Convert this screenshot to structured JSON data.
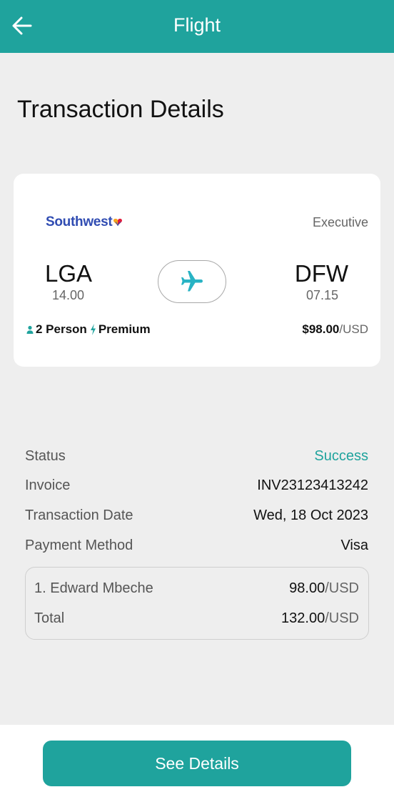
{
  "header": {
    "title": "Flight",
    "back_icon": "arrow-left-icon"
  },
  "page_title": "Transaction Details",
  "flight_card": {
    "airline": "Southwest",
    "cabin_class": "Executive",
    "origin": {
      "code": "LGA",
      "time": "14.00"
    },
    "destination": {
      "code": "DFW",
      "time": "07.15"
    },
    "route_icon": "airplane-icon",
    "passengers": "2 Person",
    "fare_type": "Premium",
    "price": "$98.00",
    "price_unit": "/USD"
  },
  "details": [
    {
      "label": "Status",
      "value": "Success"
    },
    {
      "label": "Invoice",
      "value": "INV23123413242"
    },
    {
      "label": "Transaction Date",
      "value": "Wed, 18 Oct 2023"
    },
    {
      "label": "Payment Method",
      "value": "Visa"
    }
  ],
  "summary": {
    "passenger": {
      "label": "1. Edward Mbeche",
      "amount": "98.00",
      "unit": "/USD"
    },
    "total": {
      "label": "Total",
      "amount": "132.00",
      "unit": "/USD"
    }
  },
  "footer": {
    "button_label": "See Details"
  },
  "colors": {
    "accent": "#1fa39d",
    "airline_brand": "#304cb2",
    "background": "#eeeeee"
  }
}
